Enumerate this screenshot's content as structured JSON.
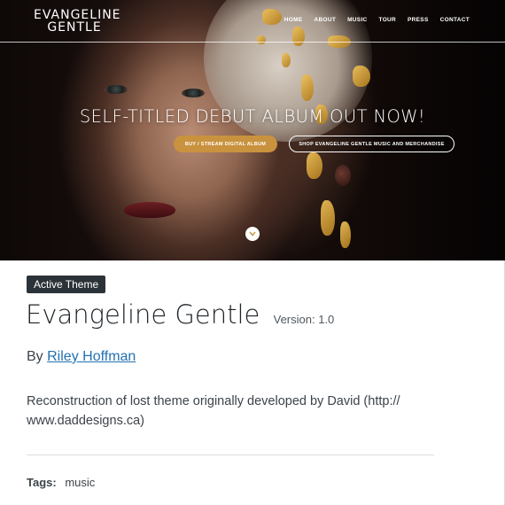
{
  "preview": {
    "logo_line1": "EVANGELINE",
    "logo_line2": "GENTLE",
    "nav": [
      "HOME",
      "ABOUT",
      "MUSIC",
      "TOUR",
      "PRESS",
      "CONTACT"
    ],
    "headline": "SELF-TITLED DEBUT ALBUM OUT NOW!",
    "buy_button": "BUY / STREAM DIGITAL ALBUM",
    "shop_button": "SHOP EVANGELINE GENTLE MUSIC AND MERCHANDISE",
    "accent_color": "#c9923e",
    "scroll_icon": "chevron-down-icon"
  },
  "theme": {
    "status_badge": "Active Theme",
    "name": "Evangeline Gentle",
    "version_label": "Version: 1.0",
    "author_prefix": "By",
    "author_name": "Riley Hoffman",
    "description": "Reconstruction of lost theme originally developed by David (http:// www.daddesigns.ca)",
    "tags_label": "Tags:",
    "tags_value": "music",
    "link_color": "#2271b1"
  }
}
